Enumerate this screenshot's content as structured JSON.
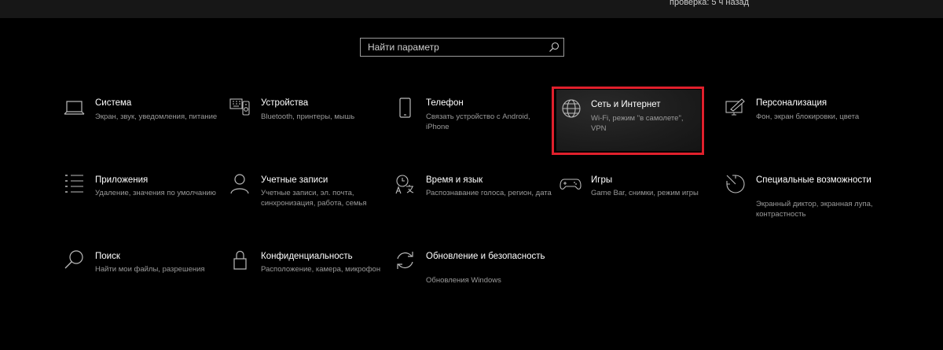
{
  "header": {
    "last_check": "проверка: 5 ч назад"
  },
  "search": {
    "placeholder": "Найти параметр",
    "value": ""
  },
  "tiles": [
    {
      "title": "Система",
      "desc": "Экран, звук, уведомления, питание",
      "icon": "laptop-icon"
    },
    {
      "title": "Устройства",
      "desc": "Bluetooth, принтеры, мышь",
      "icon": "devices-icon"
    },
    {
      "title": "Телефон",
      "desc": "Связать устройство с Android, iPhone",
      "icon": "phone-icon"
    },
    {
      "title": "Сеть и Интернет",
      "desc": "Wi-Fi, режим \"в самолете\", VPN",
      "icon": "globe-icon"
    },
    {
      "title": "Персонализация",
      "desc": "Фон, экран блокировки, цвета",
      "icon": "personalization-icon"
    },
    {
      "title": "Приложения",
      "desc": "Удаление, значения по умолчанию",
      "icon": "apps-list-icon"
    },
    {
      "title": "Учетные записи",
      "desc": "Учетные записи, эл. почта, синхронизация, работа, семья",
      "icon": "person-icon"
    },
    {
      "title": "Время и язык",
      "desc": "Распознавание голоса, регион, дата",
      "icon": "time-language-icon"
    },
    {
      "title": "Игры",
      "desc": "Game Bar, снимки, режим игры",
      "icon": "gamepad-icon"
    },
    {
      "title": "Специальные возможности",
      "desc": "Экранный диктор, экранная лупа, контрастность",
      "icon": "accessibility-icon"
    },
    {
      "title": "Поиск",
      "desc": "Найти мои файлы, разрешения",
      "icon": "search-magnifier-icon"
    },
    {
      "title": "Конфиденциальность",
      "desc": "Расположение, камера, микрофон",
      "icon": "lock-icon"
    },
    {
      "title": "Обновление и безопасность",
      "desc": "Обновления Windows",
      "icon": "update-icon"
    }
  ],
  "colors": {
    "highlight_border": "#e0202c",
    "background": "#000000",
    "desc_text": "#9a9a9a"
  }
}
